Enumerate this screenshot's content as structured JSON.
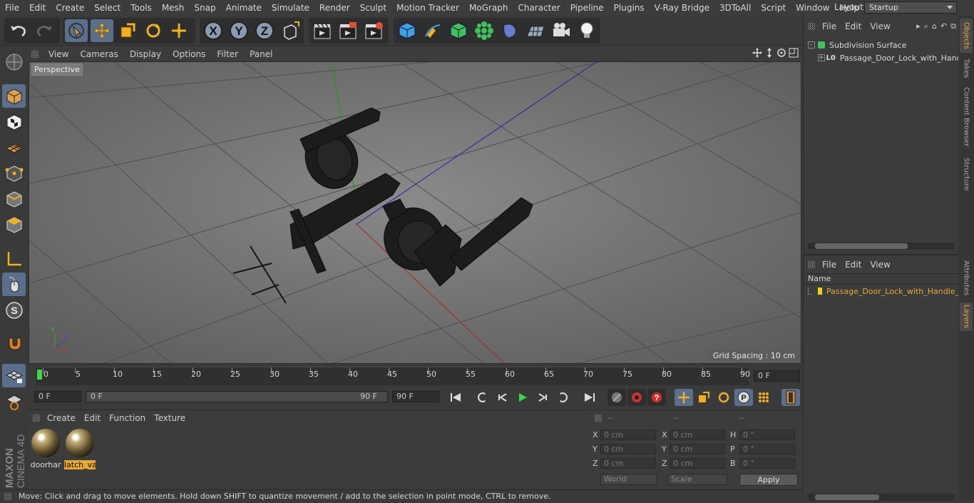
{
  "menubar": {
    "items": [
      "File",
      "Edit",
      "Create",
      "Select",
      "Tools",
      "Mesh",
      "Snap",
      "Animate",
      "Simulate",
      "Render",
      "Sculpt",
      "Motion Tracker",
      "MoGraph",
      "Character",
      "Pipeline",
      "Plugins",
      "V-Ray Bridge",
      "3DToAll",
      "Script",
      "Window",
      "Help"
    ],
    "layout_label": "Layout:",
    "layout_value": "Startup"
  },
  "viewport": {
    "menu": [
      "View",
      "Cameras",
      "Display",
      "Options",
      "Filter",
      "Panel"
    ],
    "camera_label": "Perspective",
    "grid_spacing": "Grid Spacing : 10 cm"
  },
  "timeline": {
    "ticks": [
      "0",
      "5",
      "10",
      "15",
      "20",
      "25",
      "30",
      "35",
      "40",
      "45",
      "50",
      "55",
      "60",
      "65",
      "70",
      "75",
      "80",
      "85",
      "90"
    ],
    "current_frame": "0 F"
  },
  "transport": {
    "start_field": "0 F",
    "range_start": "0 F",
    "range_end": "90 F",
    "end_field": "90 F"
  },
  "materials": {
    "menu": [
      "Create",
      "Edit",
      "Function",
      "Texture"
    ],
    "items": [
      {
        "label": "doorhar",
        "selected": false
      },
      {
        "label": "latch_va",
        "selected": true
      }
    ]
  },
  "coordinates": {
    "headers": [
      "--",
      "--",
      "--"
    ],
    "rows": [
      {
        "a": "X",
        "a_val": "0 cm",
        "b": "X",
        "b_val": "0 cm",
        "c": "H",
        "c_val": "0 °"
      },
      {
        "a": "Y",
        "a_val": "0 cm",
        "b": "Y",
        "b_val": "0 cm",
        "c": "P",
        "c_val": "0 °"
      },
      {
        "a": "Z",
        "a_val": "0 cm",
        "b": "Z",
        "b_val": "0 cm",
        "c": "B",
        "c_val": "0 °"
      }
    ],
    "mode1": "World",
    "mode2": "Scale",
    "apply": "Apply"
  },
  "objects": {
    "menu": [
      "File",
      "Edit",
      "View"
    ],
    "tree": [
      "Subdivision Surface",
      "Passage_Door_Lock_with_Handle"
    ]
  },
  "layers": {
    "menu": [
      "File",
      "Edit",
      "View"
    ],
    "column": "Name",
    "items": [
      "Passage_Door_Lock_with_Handle_"
    ],
    "layer_color": "#e8d020"
  },
  "side_tabs": [
    "Objects",
    "Takes",
    "Content Browser",
    "Structure",
    "Attributes",
    "Layers"
  ],
  "status": "Move: Click and drag to move elements. Hold down SHIFT to quantize movement / add to the selection in point mode, CTRL to remove.",
  "logo": {
    "brand": "MAXON",
    "product": "CINEMA 4D"
  },
  "colors": {
    "accent": "#5a6f8d",
    "highlight_text": "#e8a838"
  }
}
